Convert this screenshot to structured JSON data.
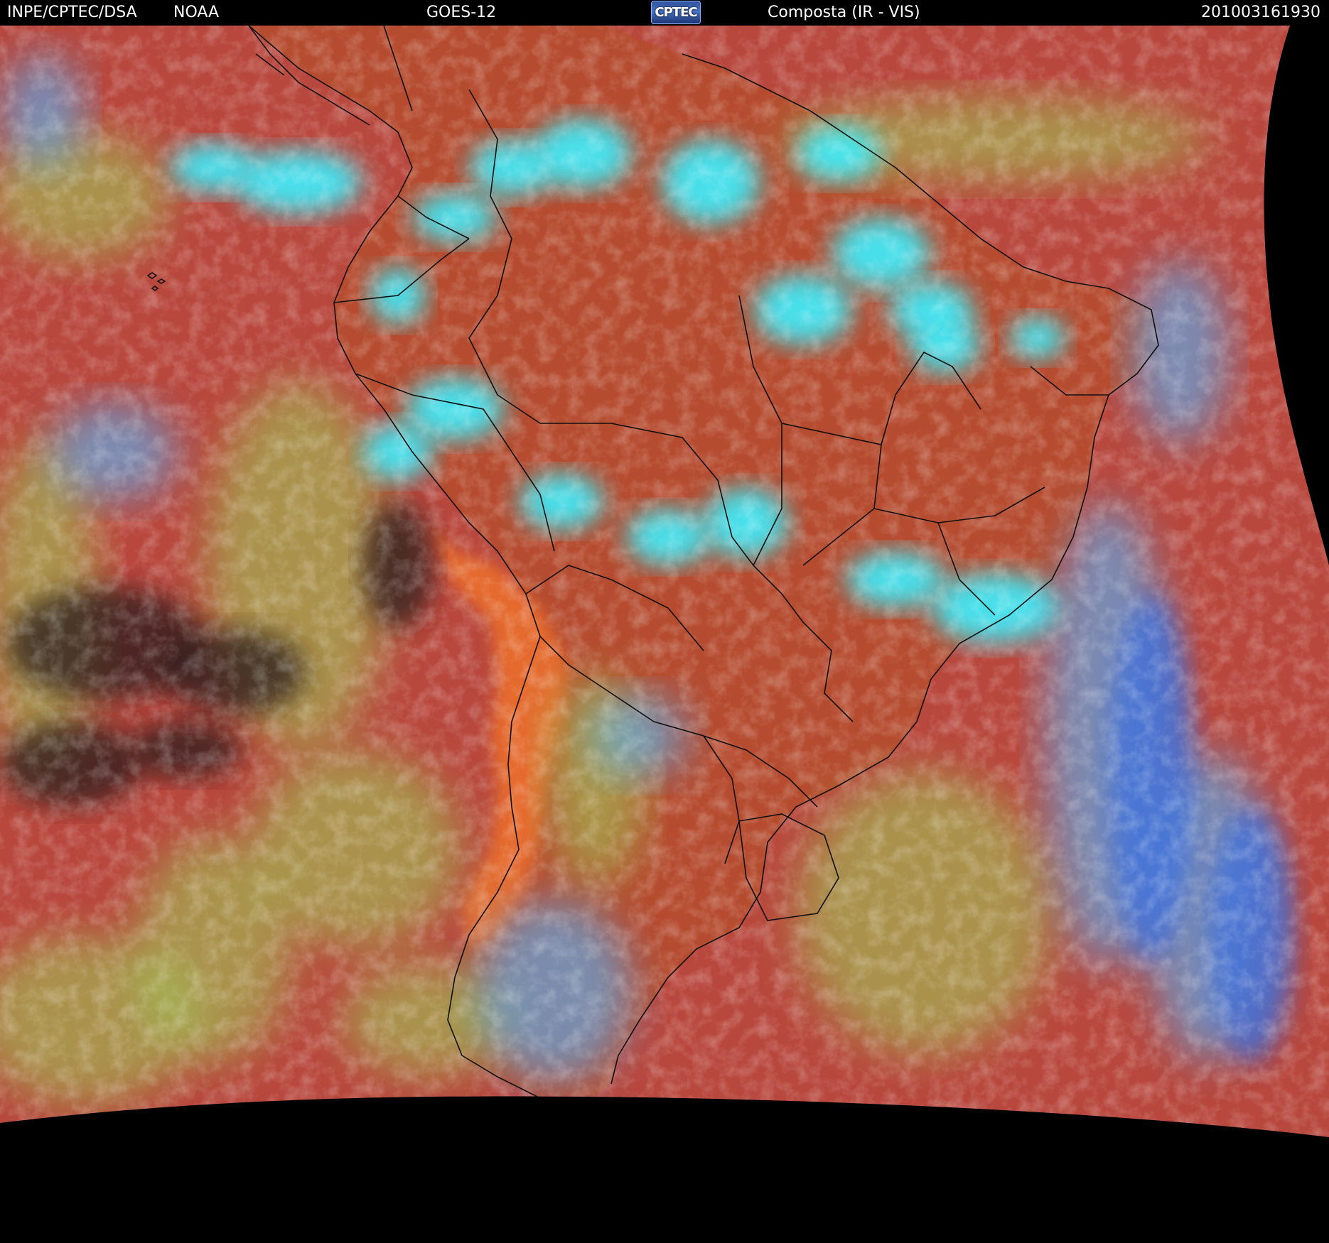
{
  "header": {
    "agency": "INPE/CPTEC/DSA",
    "partner": "NOAA",
    "satellite": "GOES-12",
    "logo_text": "CPTEC",
    "product": "Composta (IR - VIS)",
    "timestamp": "201003161930"
  },
  "colors": {
    "ocean_base": "#b8473d",
    "land_base": "#b54b2f",
    "andes_orange": "#e56b2e",
    "convective_cloud": "#3df0ff",
    "mid_cloud": "#55b8ff",
    "low_cloud_green": "#9fcf5a",
    "cirrus_blue": "#3a6fe0",
    "clear_dark": "#2a1c1c",
    "border_lines": "#101010",
    "space": "#000000"
  }
}
